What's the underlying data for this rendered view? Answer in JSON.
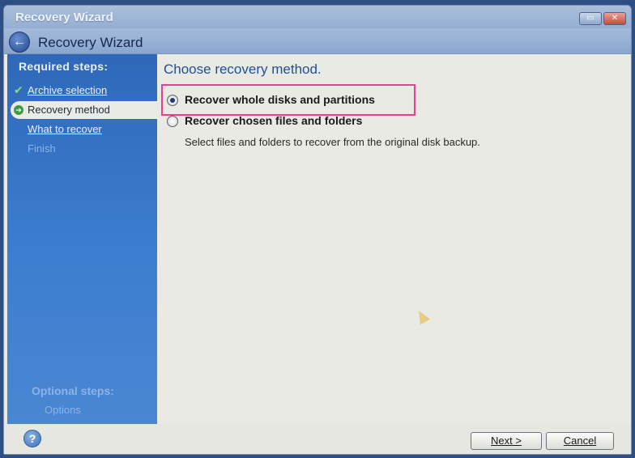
{
  "window": {
    "title": "Recovery Wizard",
    "header_title": "Recovery Wizard"
  },
  "sidebar": {
    "required_heading": "Required steps:",
    "items": [
      {
        "label": "Archive selection",
        "state": "done"
      },
      {
        "label": "Recovery method",
        "state": "current"
      },
      {
        "label": "What to recover",
        "state": "link"
      },
      {
        "label": "Finish",
        "state": "disabled"
      }
    ],
    "optional_heading": "Optional steps:",
    "optional_items": [
      {
        "label": "Options"
      }
    ]
  },
  "content": {
    "title": "Choose recovery method.",
    "options": [
      {
        "label": "Recover whole disks and partitions",
        "checked": true
      },
      {
        "label": "Recover chosen files and folders",
        "checked": false
      }
    ],
    "description": "Select files and folders to recover from the original disk backup."
  },
  "footer": {
    "next_label": "Next >",
    "cancel_label": "Cancel"
  },
  "icons": {
    "back": "back-arrow-icon",
    "help": "help-icon",
    "check": "checkmark-icon",
    "current": "current-step-arrow-icon"
  },
  "colors": {
    "sidebar": "#3a78cc",
    "title_accent": "#1f4f9a",
    "highlight": "#e83f8f"
  }
}
